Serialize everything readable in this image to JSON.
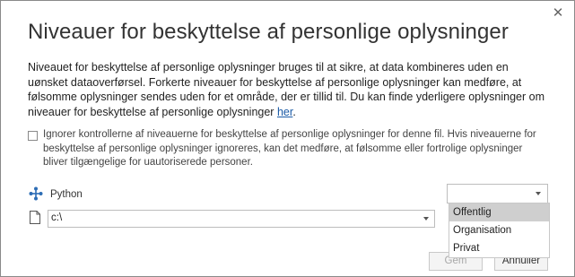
{
  "dialog": {
    "title": "Niveauer for beskyttelse af personlige oplysninger",
    "close_glyph": "✕",
    "description": "Niveauet for beskyttelse af personlige oplysninger bruges til at sikre, at data kombineres uden en uønsket dataoverførsel. Forkerte niveauer for beskyttelse af personlige oplysninger kan medføre, at følsomme oplysninger sendes uden for et område, der er tillid til. Du kan finde yderligere oplysninger om niveauer for beskyttelse af personlige oplysninger ",
    "link_text": "her",
    "link_suffix": ".",
    "ignore_checkbox": {
      "checked": false,
      "label": "Ignorer kontrollerne af niveauerne for beskyttelse af personlige oplysninger for denne fil. Hvis niveauerne for beskyttelse af personlige oplysninger ignoreres, kan det medføre, at følsomme eller fortrolige oplysninger bliver tilgængelige for uautoriserede personer."
    },
    "source": {
      "icon": "python-icon",
      "label": "Python",
      "path_value": "c:\\"
    },
    "privacy_level": {
      "selected": "",
      "options": [
        "Offentlig",
        "Organisation",
        "Privat"
      ],
      "highlighted": "Offentlig"
    },
    "buttons": {
      "save_label": "Gem",
      "cancel_label": "Annuller"
    }
  }
}
